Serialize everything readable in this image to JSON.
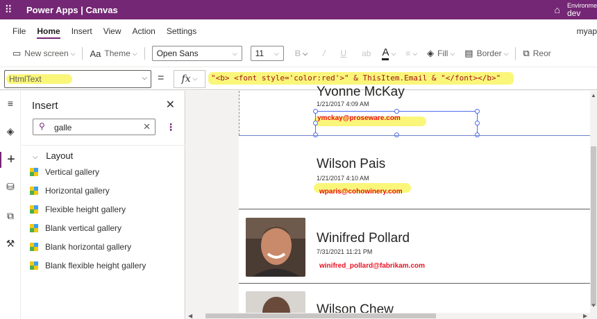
{
  "app": {
    "title": "Power Apps  |  Canvas",
    "env_label": "Environme",
    "env_name": "dev"
  },
  "menu": {
    "tabs": [
      "File",
      "Home",
      "Insert",
      "View",
      "Action",
      "Settings"
    ],
    "active": "Home",
    "user": "myap"
  },
  "ribbon": {
    "new_screen": "New screen",
    "theme": "Theme",
    "font": "Open Sans",
    "font_size": "11",
    "fill": "Fill",
    "border": "Border",
    "reorder": "Reor"
  },
  "formula_bar": {
    "property": "HtmlText",
    "fx": "fx",
    "formula": "\"<b> <font style='color:red'>\" & ThisItem.Email & \"</font></b>\""
  },
  "insert_panel": {
    "title": "Insert",
    "search_value": "galle",
    "category": "Layout",
    "items": [
      "Vertical gallery",
      "Horizontal gallery",
      "Flexible height gallery",
      "Blank vertical gallery",
      "Blank horizontal gallery",
      "Blank flexible height gallery"
    ]
  },
  "gallery": {
    "rows": [
      {
        "name": "Yvonne McKay",
        "date": "1/21/2017 4:09 AM",
        "email": "ymckay@proseware.com"
      },
      {
        "name": "Wilson Pais",
        "date": "1/21/2017 4:10 AM",
        "email": "wparis@cohowinery.com"
      },
      {
        "name": "Winifred Pollard",
        "date": "7/31/2021 11:21 PM",
        "email": "winifred_pollard@fabrikam.com"
      },
      {
        "name": "Wilson Chew"
      }
    ]
  },
  "colors": {
    "brand": "#742774",
    "highlight": "#faf67a",
    "email_red": "#e81123",
    "selection": "#4f6bed"
  }
}
